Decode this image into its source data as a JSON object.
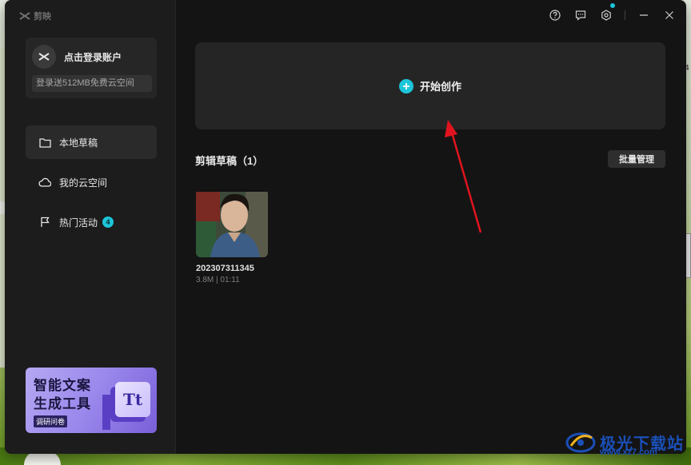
{
  "app": {
    "name": "剪映"
  },
  "account": {
    "login_prompt": "点击登录账户",
    "cloud_offer": "登录送512MB免费云空间"
  },
  "sidebar": {
    "items": [
      {
        "label": "本地草稿",
        "icon": "folder-icon",
        "active": true
      },
      {
        "label": "我的云空间",
        "icon": "cloud-icon",
        "active": false
      },
      {
        "label": "热门活动",
        "icon": "flag-icon",
        "active": false,
        "badge": "4"
      }
    ]
  },
  "banner": {
    "line1": "智能文案",
    "line2": "生成工具",
    "sub": "调研问卷",
    "glyph": "Tt"
  },
  "titlebar": {
    "icons": [
      "help-icon",
      "feedback-icon",
      "settings-icon",
      "minimize-icon",
      "close-icon"
    ],
    "settings_dot_color": "#1cc6d9"
  },
  "main": {
    "create_label": "开始创作",
    "drafts_title": "剪辑草稿（1）",
    "batch_label": "批量管理",
    "drafts": [
      {
        "name": "202307311345",
        "meta": "3.8M | 01:11"
      }
    ]
  },
  "annotation": {
    "type": "red-arrow",
    "color": "#e0141e",
    "points_to": "create-panel"
  },
  "watermark": {
    "text": "极光下载站",
    "url": "www.xz7.com"
  },
  "colors": {
    "accent": "#1cc6d9",
    "window_bg": "#141414",
    "sidebar_bg": "#1c1c1c",
    "panel_bg": "#252525"
  }
}
